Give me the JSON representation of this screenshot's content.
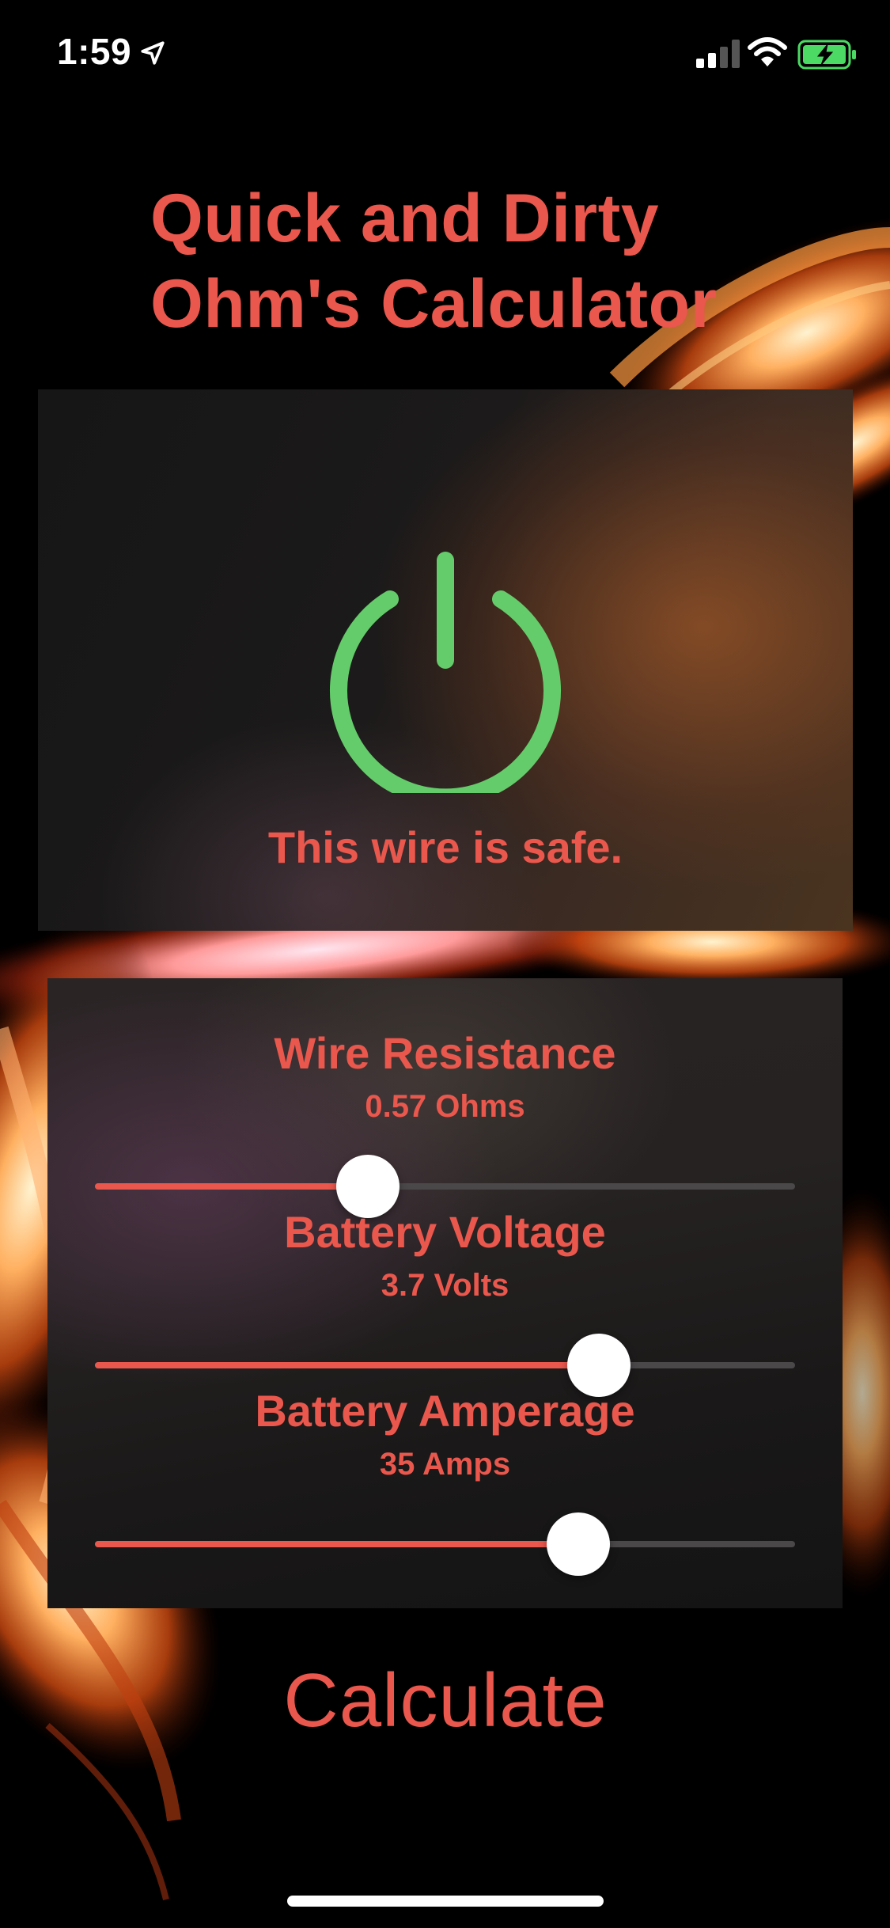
{
  "status_bar": {
    "time": "1:59",
    "location_icon": "location-arrow-icon",
    "signal_icon": "cellular-signal-icon",
    "wifi_icon": "wifi-icon",
    "battery_icon": "battery-charging-icon",
    "battery_color": "#4CD964"
  },
  "title": {
    "line1": "Quick and Dirty",
    "line2": "Ohm's Calculator"
  },
  "status_panel": {
    "icon": "power-icon",
    "icon_color": "#64CC6A",
    "message": "This wire is safe."
  },
  "controls": [
    {
      "label": "Wire Resistance",
      "value_text": "0.57 Ohms",
      "slider_fraction": 0.39
    },
    {
      "label": "Battery Voltage",
      "value_text": "3.7 Volts",
      "slider_fraction": 0.72
    },
    {
      "label": "Battery Amperage",
      "value_text": "35 Amps",
      "slider_fraction": 0.69
    }
  ],
  "calculate_button": {
    "label": "Calculate"
  },
  "colors": {
    "accent": "#E9574D",
    "background": "#000000",
    "slider_track": "#4A4848",
    "thumb": "#FFFFFF"
  }
}
